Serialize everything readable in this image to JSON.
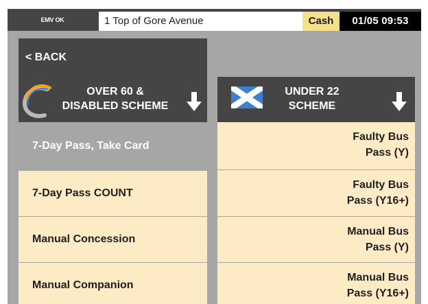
{
  "status_bar": {
    "emv_status": "EMV OK",
    "current_stop": "1  Top of Gore Avenue",
    "payment_mode": "Cash",
    "datetime": "01/05  09:53"
  },
  "back_button": {
    "label": "< BACK"
  },
  "left_category": {
    "title_line1": "OVER 60 &",
    "title_line2": "DISABLED SCHEME",
    "icon": "c-swoosh-logo",
    "arrow_icon": "down-arrow-icon"
  },
  "right_category": {
    "title_line1": "UNDER 22",
    "title_line2": "SCHEME",
    "icon": "saltire-flag-icon",
    "arrow_icon": "down-arrow-icon"
  },
  "left_options": [
    {
      "label": "7-Day Pass, Take Card"
    },
    {
      "label": "7-Day Pass COUNT"
    },
    {
      "label": "Manual Concession"
    },
    {
      "label": "Manual Companion"
    }
  ],
  "right_options": [
    {
      "line1": "Faulty Bus",
      "line2": "Pass (Y)"
    },
    {
      "line1": "Faulty Bus",
      "line2": "Pass (Y16+)"
    },
    {
      "line1": "Manual Bus",
      "line2": "Pass (Y)"
    },
    {
      "line1": "Manual Bus",
      "line2": "Pass (Y16+)"
    }
  ],
  "colors": {
    "panel_dark": "#454545",
    "background_gray": "#a6a6a6",
    "option_cream": "#fcebc4",
    "cash_yellow": "#f7e08a",
    "flag_blue": "#3f7fd0"
  }
}
